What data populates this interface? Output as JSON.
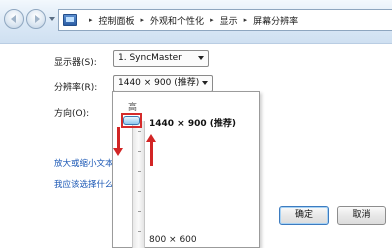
{
  "breadcrumb": {
    "items": [
      "控制面板",
      "外观和个性化",
      "显示",
      "屏幕分辨率"
    ],
    "separator": "▸"
  },
  "form": {
    "display_label": "显示器(S):",
    "display_value": "1. SyncMaster",
    "resolution_label": "分辨率(R):",
    "resolution_value": "1440 × 900 (推荐)",
    "orientation_label": "方向(O):"
  },
  "links": {
    "enlarge_text": "放大或缩小文本",
    "what_to_choose": "我应该选择什么"
  },
  "resolution_popup": {
    "high_label": "高",
    "selected_resolution": "1440 × 900 (推荐)",
    "lowest_resolution": "800 × 600",
    "slider_level": 1.0
  },
  "buttons": {
    "ok_label": "确定",
    "cancel_label": "取消"
  },
  "colors": {
    "annotation_red": "#d22525",
    "link_blue": "#1a57b5"
  },
  "icons": {
    "back": "back-arrow-icon",
    "forward": "forward-arrow-icon",
    "control_panel": "control-panel-icon",
    "dropdown": "chevron-down-icon"
  }
}
